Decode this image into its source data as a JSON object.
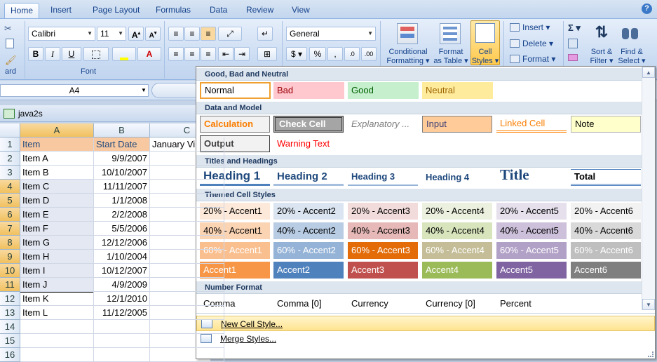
{
  "tabs": [
    "Home",
    "Insert",
    "Page Layout",
    "Formulas",
    "Data",
    "Review",
    "View"
  ],
  "ribbon": {
    "font_name": "Calibri",
    "font_size": "11",
    "number_format": "General",
    "group_clipboard": "ard",
    "group_font": "Font",
    "conditional_formatting": [
      "Conditional",
      "Formatting ▾"
    ],
    "format_as_table": [
      "Format",
      "as Table ▾"
    ],
    "cell_styles": [
      "Cell",
      "Styles ▾"
    ],
    "insert_label": "Insert ▾",
    "delete_label": "Delete ▾",
    "format_label": "Format ▾",
    "sigma": "Σ ▾",
    "sort_filter": [
      "Sort &",
      "Filter ▾"
    ],
    "find_select": [
      "Find &",
      "Select ▾"
    ],
    "bold": "B",
    "italic": "I",
    "underline": "U",
    "font_color": "A",
    "currency": "$ ▾",
    "percent": "%",
    "comma": ","
  },
  "name_box": "A4",
  "workbook_title": "java2s",
  "sheet": {
    "columns": [
      "A",
      "B",
      "C"
    ],
    "rows": [
      "1",
      "2",
      "3",
      "4",
      "5",
      "6",
      "7",
      "8",
      "9",
      "10",
      "11",
      "12",
      "13",
      "14",
      "15",
      "16"
    ],
    "cells": [
      [
        "Item",
        "Start Date",
        "January Vi"
      ],
      [
        "Item A",
        "9/9/2007",
        ""
      ],
      [
        "Item B",
        "10/10/2007",
        ""
      ],
      [
        "Item C",
        "11/11/2007",
        ""
      ],
      [
        "Item D",
        "1/1/2008",
        ""
      ],
      [
        "Item E",
        "2/2/2008",
        ""
      ],
      [
        "Item F",
        "5/5/2006",
        ""
      ],
      [
        "Item G",
        "12/12/2006",
        ""
      ],
      [
        "Item H",
        "1/10/2004",
        ""
      ],
      [
        "Item I",
        "10/12/2007",
        ""
      ],
      [
        "Item J",
        "4/9/2009",
        ""
      ],
      [
        "Item K",
        "12/1/2010",
        ""
      ],
      [
        "Item L",
        "11/12/2005",
        ""
      ],
      [
        "",
        "",
        ""
      ],
      [
        "",
        "",
        ""
      ],
      [
        "",
        "",
        ""
      ]
    ]
  },
  "gallery": {
    "sections": {
      "good_bad": "Good, Bad and Neutral",
      "data_model": "Data and Model",
      "titles": "Titles and Headings",
      "themed": "Themed Cell Styles",
      "number": "Number Format"
    },
    "good_bad": [
      "Normal",
      "Bad",
      "Good",
      "Neutral"
    ],
    "data_model_row1": [
      "Calculation",
      "Check Cell",
      "Explanatory ...",
      "Input",
      "Linked Cell",
      "Note"
    ],
    "data_model_row2": [
      "Output",
      "Warning Text"
    ],
    "titles": [
      "Heading 1",
      "Heading 2",
      "Heading 3",
      "Heading 4",
      "Title",
      "Total"
    ],
    "accent20": [
      "20% - Accent1",
      "20% - Accent2",
      "20% - Accent3",
      "20% - Accent4",
      "20% - Accent5",
      "20% - Accent6"
    ],
    "accent40": [
      "40% - Accent1",
      "40% - Accent2",
      "40% - Accent3",
      "40% - Accent4",
      "40% - Accent5",
      "40% - Accent6"
    ],
    "accent60": [
      "60% - Accent1",
      "60% - Accent2",
      "60% - Accent3",
      "60% - Accent4",
      "60% - Accent5",
      "60% - Accent6"
    ],
    "accent": [
      "Accent1",
      "Accent2",
      "Accent3",
      "Accent4",
      "Accent5",
      "Accent6"
    ],
    "number_format": [
      "Comma",
      "Comma [0]",
      "Currency",
      "Currency [0]",
      "Percent"
    ],
    "new_cell_style": "New Cell Style...",
    "merge_styles": "Merge Styles..."
  },
  "colors": {
    "accent20": [
      "#fde9d9",
      "#dbe5f1",
      "#f2dcdb",
      "#ebf1de",
      "#e5e0ec",
      "#f2f2f2"
    ],
    "accent40": [
      "#fbd4b4",
      "#b8cce4",
      "#e6b9b8",
      "#d7e4bc",
      "#ccc0da",
      "#d9d9d9"
    ],
    "accent60": [
      "#fabf8f",
      "#95b3d7",
      "#e36c09",
      "#c4bd97",
      "#b2a1c7",
      "#bfbfbf"
    ],
    "accent": [
      "#f79646",
      "#4f81bd",
      "#c0504d",
      "#9bbb59",
      "#8064a2",
      "#7f7f7f"
    ]
  }
}
